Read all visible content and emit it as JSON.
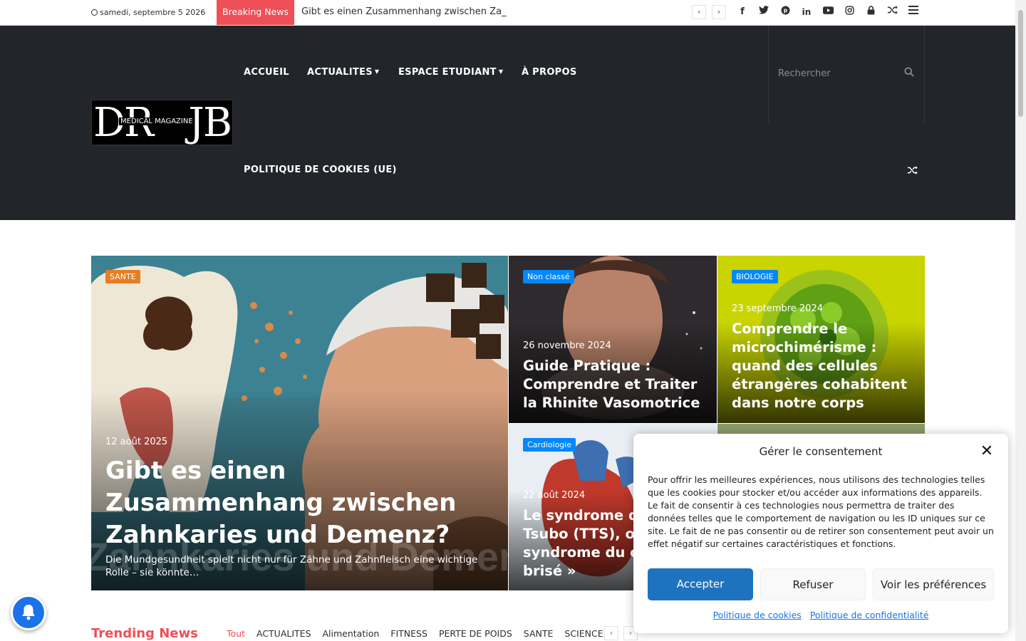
{
  "topbar": {
    "date": "samedi, septembre 5 2026",
    "breaking_label": "Breaking News",
    "ticker_text": "Gibt es einen Zusammenhang zwischen Za_",
    "prev": "‹",
    "next": "›",
    "icons": [
      "facebook-icon",
      "twitter-icon",
      "pinterest-icon",
      "linkedin-icon",
      "youtube-icon",
      "instagram-icon",
      "lock-icon",
      "random-icon",
      "menu-icon"
    ]
  },
  "header": {
    "logo_left": "DR",
    "logo_right": "JB",
    "logo_sub": "MEDICAL MAGAZINE",
    "nav": [
      {
        "label": "ACCUEIL"
      },
      {
        "label": "ACTUALITES"
      },
      {
        "label": "ESPACE ETUDIANT"
      },
      {
        "label": "À PROPOS"
      },
      {
        "label": "POLITIQUE DE COOKIES (UE)"
      }
    ],
    "search_placeholder": "Rechercher"
  },
  "featured": [
    {
      "tag": "SANTE",
      "tag_color": "#e67e22",
      "date": "12 août 2025",
      "title": "Gibt es einen Zusammenhang zwischen Zahnkaries und Demenz?",
      "excerpt": "Die Mundgesundheit spielt nicht nur für Zähne und Zahnfleisch eine wichtige Rolle – sie könnte…",
      "watermark": "Zahnkaries und Demenz"
    },
    {
      "tag": "Non classé",
      "tag_color": "#0088ff",
      "date": "26 novembre 2024",
      "title": "Guide Pratique : Comprendre et Traiter la Rhinite Vasomotrice"
    },
    {
      "tag": "BIOLOGIE",
      "tag_color": "#0088ff",
      "date": "23 septembre 2024",
      "title": "Comprendre le microchimérisme : quand des cellules étrangères cohabitent dans notre corps"
    },
    {
      "tag": "Cardiologie",
      "tag_color": "#0088ff",
      "date": "22 août 2024",
      "title": "Le syndrome de Tako Tsubo (TTS), ou « syndrome du cœur brisé »"
    }
  ],
  "trending": {
    "title": "Trending News",
    "filters": [
      "Tout",
      "ACTUALITES",
      "Alimentation",
      "FITNESS",
      "PERTE DE POIDS",
      "SANTE",
      "SCIENCE"
    ]
  },
  "consent": {
    "title": "Gérer le consentement",
    "body": "Pour offrir les meilleures expériences, nous utilisons des technologies telles que les cookies pour stocker et/ou accéder aux informations des appareils. Le fait de consentir à ces technologies nous permettra de traiter des données telles que le comportement de navigation ou les ID uniques sur ce site. Le fait de ne pas consentir ou de retirer son consentement peut avoir un effet négatif sur certaines caractéristiques et fonctions.",
    "accept": "Accepter",
    "refuse": "Refuser",
    "preferences": "Voir les préférences",
    "cookie_policy": "Politique de cookies",
    "privacy_policy": "Politique de confidentialité"
  },
  "colors": {
    "accent": "#ef4f56",
    "header_bg": "#22252a",
    "button_blue": "#1a73e8"
  }
}
